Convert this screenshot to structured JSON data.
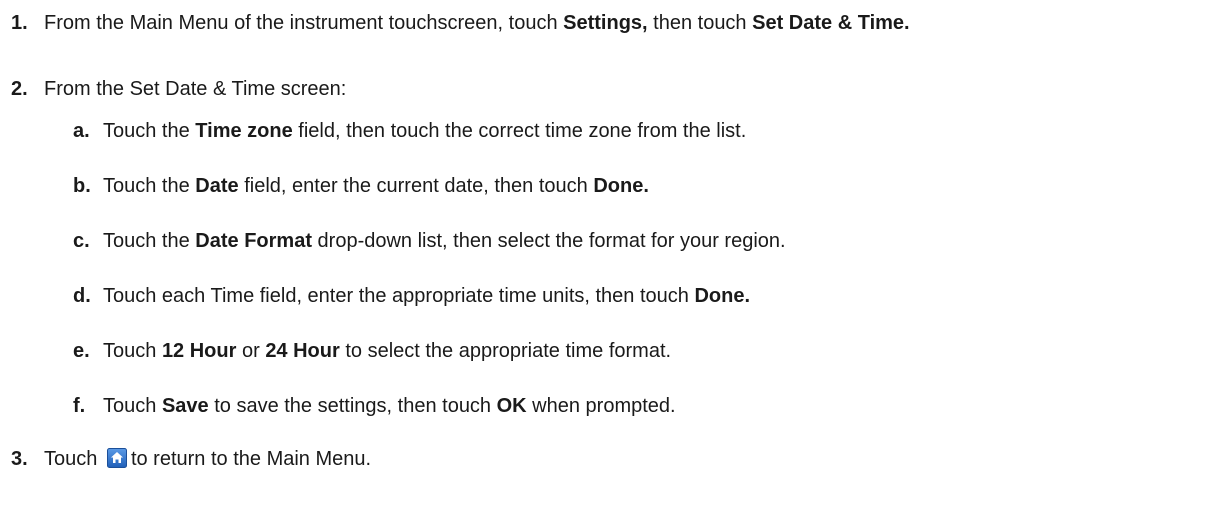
{
  "steps": [
    {
      "num": "1.",
      "parts": [
        "From the Main Menu of the instrument touchscreen, touch ",
        "Settings,",
        " then touch ",
        "Set Date & Time."
      ]
    },
    {
      "num": "2.",
      "parts": [
        "From the Set Date & Time screen:"
      ],
      "substeps": [
        {
          "num": "a.",
          "parts": [
            "Touch the ",
            "Time zone",
            " field, then touch the correct time zone from the list."
          ]
        },
        {
          "num": "b.",
          "parts": [
            "Touch the ",
            "Date",
            " field, enter the current date, then touch ",
            "Done."
          ]
        },
        {
          "num": "c.",
          "parts": [
            "Touch the ",
            "Date Format",
            " drop-down list, then select the format for your region."
          ]
        },
        {
          "num": "d.",
          "parts": [
            "Touch each Time field, enter the appropriate time units, then touch ",
            "Done."
          ]
        },
        {
          "num": "e.",
          "parts": [
            "Touch ",
            "12 Hour",
            " or ",
            "24 Hour",
            " to select the appropriate time format."
          ]
        },
        {
          "num": "f.",
          "parts": [
            "Touch ",
            "Save",
            " to save the settings, then touch ",
            "OK",
            " when prompted."
          ]
        }
      ]
    },
    {
      "num": "3.",
      "parts": [
        "Touch ",
        "",
        "to return to the Main Menu."
      ],
      "icon": "home-icon",
      "icon_color": "#2a6cc4"
    }
  ]
}
